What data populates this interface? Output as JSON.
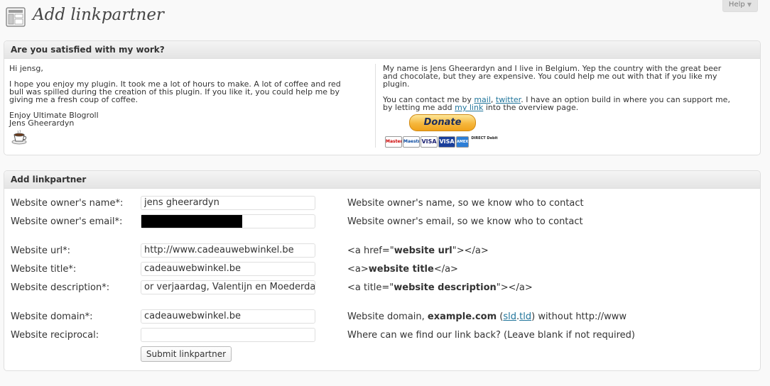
{
  "header": {
    "title": "Add linkpartner",
    "help_label": "Help",
    "help_arrow": "▼"
  },
  "satisfied_box": {
    "title": "Are you satisfied with my work?",
    "left": {
      "greeting": "Hi jensg,",
      "para_line1": "I hope you enjoy my plugin. It took me a lot of hours to make. A lot of coffee and red",
      "para_line2": "bull was spilled during the creation of this plugin. If you like it, you could help me by",
      "para_line3": "giving me a fresh coup of coffee.",
      "enjoy": "Enjoy Ultimate Blogroll",
      "signature": "Jens Gheerardyn",
      "coffee_icon": "coffee-cup-icon"
    },
    "right": {
      "intro_line1": "My name is Jens Gheerardyn and I live in Belgium. Yep the country with the great beer",
      "intro_line2": "and chocolate, but they are expensive. You could help me out with that if you like my",
      "intro_line3": "plugin.",
      "contact_prefix": "You can contact me by ",
      "mail_link": "mail",
      "comma": ", ",
      "twitter_link": "twitter",
      "contact_suffix": ". I have an option build in where you can support me,",
      "contact_line2_prefix": "by letting me add ",
      "my_link": "my link",
      "contact_line2_suffix": " into the overview page.",
      "donate_label": "Donate",
      "cards": [
        "MasterCard",
        "Maestro",
        "VISA",
        "VISA",
        "AMEX",
        "DIRECT Debit"
      ]
    }
  },
  "form_box": {
    "title": "Add linkpartner",
    "fields": {
      "owner_name": {
        "label": "Website owner's name*:",
        "value": "jens gheerardyn",
        "help": "Website owner's name, so we know who to contact"
      },
      "owner_email": {
        "label": "Website owner's email*:",
        "value": "",
        "help": "Website owner's email, so we know who to contact"
      },
      "url": {
        "label": "Website url*:",
        "value": "http://www.cadeauwebwinkel.be",
        "help_prefix": "<a href=\"",
        "help_bold": "website url",
        "help_suffix": "\"></a>"
      },
      "title": {
        "label": "Website title*:",
        "value": "cadeauwebwinkel.be",
        "help_prefix": "<a>",
        "help_bold": "website title",
        "help_suffix": "</a>"
      },
      "description": {
        "label": "Website description*:",
        "value": "or verjaardag, Valentijn en Moederdag",
        "help_prefix": "<a title=\"",
        "help_bold": "website description",
        "help_suffix": "\"></a>"
      },
      "domain": {
        "label": "Website domain*:",
        "value": "cadeauwebwinkel.be",
        "help_prefix": "Website domain, ",
        "help_bold": "example.com",
        "help_paren_open": " (",
        "help_link1": "sld",
        "help_dot": ".",
        "help_link2": "tld",
        "help_suffix": ") without http://www"
      },
      "reciprocal": {
        "label": "Website reciprocal:",
        "value": "",
        "help": "Where can we find our link back? (Leave blank if not required)"
      }
    },
    "submit_label": "Submit linkpartner"
  },
  "colors": {
    "link": "#21759b",
    "box_border": "#dfdfdf",
    "donate_orange": "#f6b73c"
  }
}
